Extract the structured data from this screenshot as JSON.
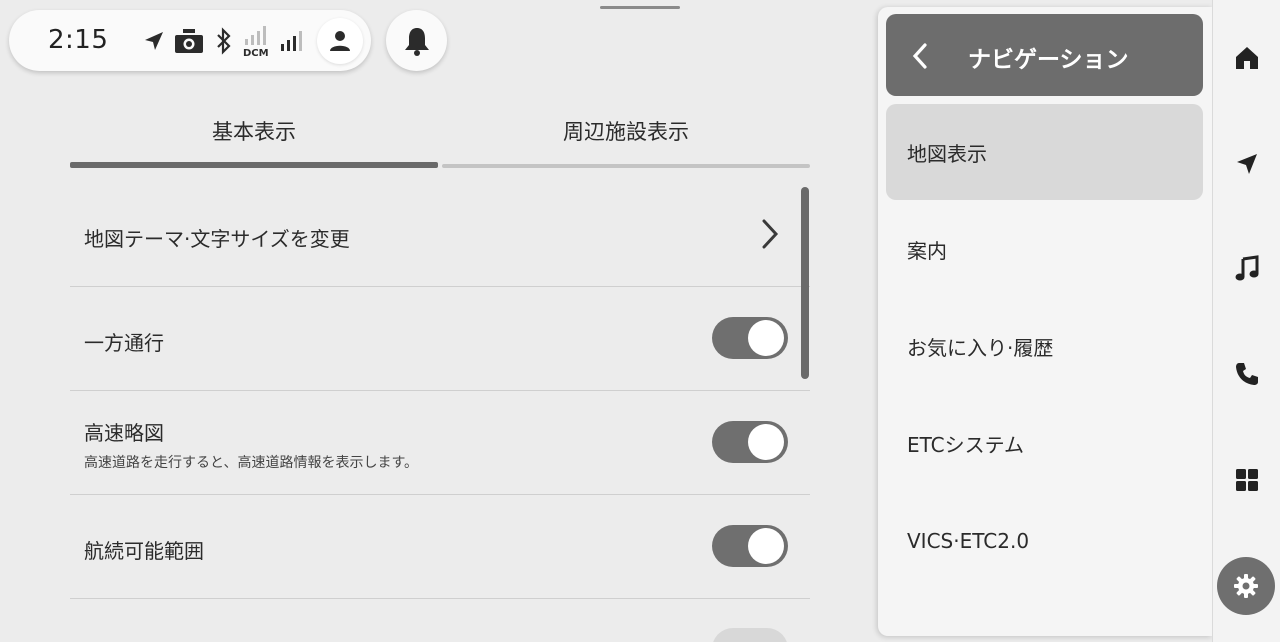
{
  "status_bar": {
    "time": "2:15",
    "network_label": "DCM",
    "icons": [
      "navigation-arrow-icon",
      "camera-icon",
      "bluetooth-icon",
      "signal-icon",
      "signal-icon",
      "user-icon",
      "bell-icon"
    ]
  },
  "tabs": [
    {
      "label": "基本表示",
      "active": true
    },
    {
      "label": "周辺施設表示",
      "active": false
    }
  ],
  "settings": [
    {
      "title": "地図テーマ·文字サイズを変更",
      "control": "chevron"
    },
    {
      "title": "一方通行",
      "control": "toggle",
      "on": true
    },
    {
      "title": "高速略図",
      "subtitle": "高速道路を走行すると、高速道路情報を表示します。",
      "control": "toggle",
      "on": true
    },
    {
      "title": "航続可能範囲",
      "control": "toggle",
      "on": true
    }
  ],
  "side_panel": {
    "title": "ナビゲーション",
    "items": [
      {
        "label": "地図表示",
        "active": true
      },
      {
        "label": "案内"
      },
      {
        "label": "お気に入り·履歴"
      },
      {
        "label": "ETCシステム"
      },
      {
        "label": "VICS·ETC2.0"
      }
    ]
  },
  "nav_rail": [
    "home-icon",
    "navigation-icon",
    "music-icon",
    "phone-icon",
    "apps-grid-icon",
    "settings-gear-icon"
  ],
  "colors": {
    "background": "#ececec",
    "accent_dark": "#6d6d6d",
    "toggle_on": "#6f6f6f",
    "active_item": "#d9d9d9"
  }
}
